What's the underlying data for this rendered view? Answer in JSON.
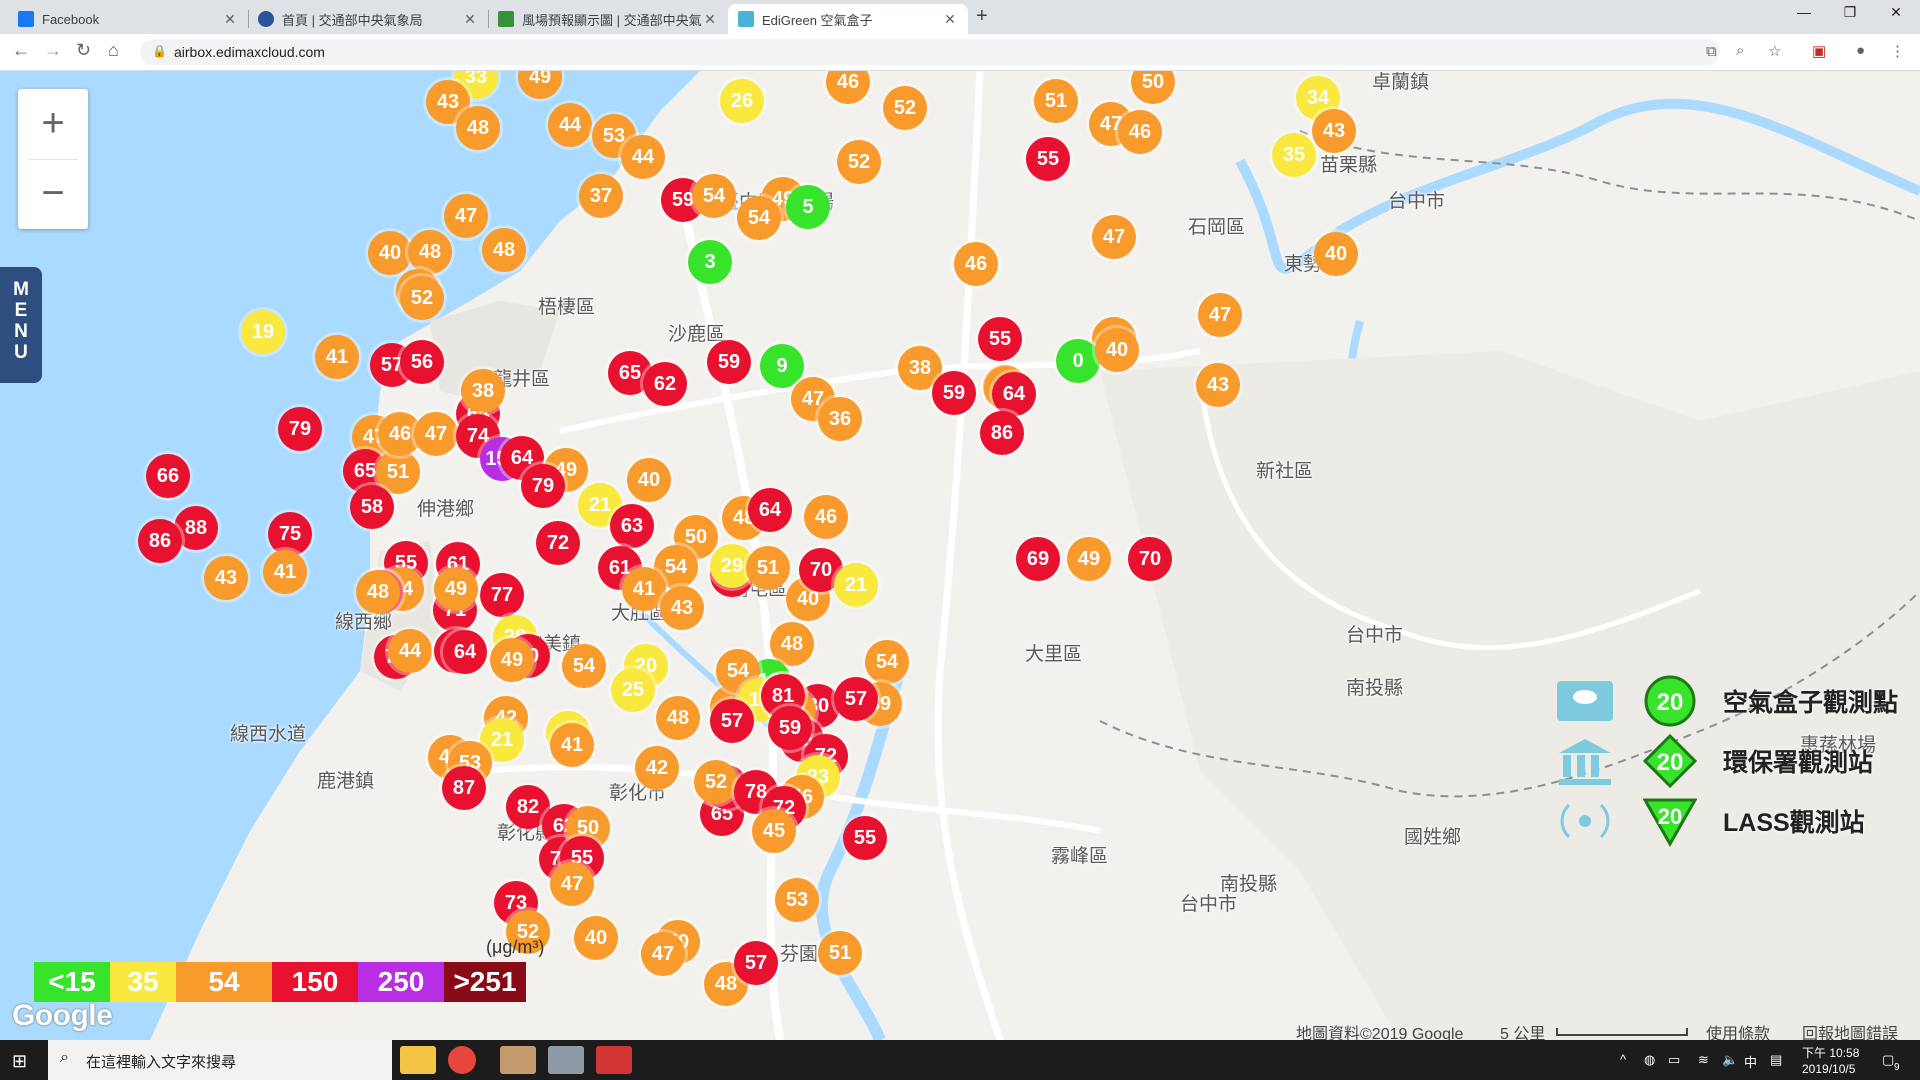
{
  "browser": {
    "tabs": [
      {
        "label": "Facebook",
        "icon_color": "#1877f2",
        "active": false
      },
      {
        "label": "首頁 | 交通部中央氣象局",
        "icon_color": "#2a5599",
        "active": false
      },
      {
        "label": "風場預報顯示圖 | 交通部中央氣象",
        "icon_color": "#3a8f3a",
        "active": false
      },
      {
        "label": "EdiGreen 空氣盒子",
        "icon_color": "#4ab4d8",
        "active": true
      }
    ],
    "url": "airbox.edimaxcloud.com"
  },
  "menu_label": "MENU",
  "map": {
    "labels": [
      {
        "text": "臺中國際機場"
      },
      {
        "text": "卓蘭鎮"
      },
      {
        "text": "東勢區"
      },
      {
        "text": "新社區"
      },
      {
        "text": "沙鹿區"
      },
      {
        "text": "龍井區"
      },
      {
        "text": "大肚區"
      },
      {
        "text": "線西鄉"
      },
      {
        "text": "鹿港鎮"
      },
      {
        "text": "彰化縣"
      },
      {
        "text": "彰化市"
      },
      {
        "text": "台中市"
      },
      {
        "text": "南投縣"
      },
      {
        "text": "國姓鄉"
      },
      {
        "text": "霧峰區"
      },
      {
        "text": "芬園鄉"
      },
      {
        "text": "惠蓀林場"
      },
      {
        "text": "苗栗縣"
      },
      {
        "text": "台中市"
      },
      {
        "text": "石岡區"
      },
      {
        "text": "梧棲區"
      },
      {
        "text": "伸港鄉"
      },
      {
        "text": "和美鎮"
      },
      {
        "text": "線西水道"
      },
      {
        "text": "南屯區"
      },
      {
        "text": "大里區"
      },
      {
        "text": "台中市"
      },
      {
        "text": "南投縣"
      }
    ],
    "markers": [
      33,
      49,
      43,
      48,
      44,
      53,
      26,
      46,
      52,
      51,
      50,
      34,
      43,
      35,
      47,
      46,
      55,
      44,
      37,
      59,
      54,
      49,
      5,
      54,
      52,
      47,
      47,
      46,
      40,
      48,
      48,
      50,
      52,
      40,
      3,
      47,
      40,
      55,
      38,
      50,
      19,
      64,
      41,
      57,
      56,
      38,
      65,
      62,
      59,
      9,
      47,
      36,
      50,
      0,
      40,
      43,
      59,
      64,
      86,
      79,
      47,
      65,
      51,
      46,
      47,
      74,
      151,
      64,
      49,
      79,
      40,
      21,
      48,
      46,
      66,
      88,
      86,
      75,
      58,
      63,
      72,
      50,
      64,
      70,
      69,
      49,
      43,
      41,
      55,
      44,
      56,
      48,
      61,
      71,
      77,
      54,
      61,
      41,
      63,
      29,
      40,
      51,
      70,
      21,
      78,
      44,
      71,
      64,
      49,
      28,
      60,
      43,
      48,
      12,
      41,
      54,
      80,
      39,
      57,
      49,
      54,
      20,
      25,
      54,
      42,
      21,
      32,
      48,
      15,
      37,
      38,
      66,
      72,
      23,
      81,
      42,
      41,
      59,
      57,
      65,
      61,
      52,
      46,
      78,
      72,
      45,
      44,
      53,
      87,
      82,
      62,
      72,
      50,
      55,
      47,
      73,
      52,
      40,
      40,
      48,
      57,
      47,
      53,
      51,
      55
    ]
  },
  "legend": {
    "scale": [
      {
        "label": "<15",
        "color": "#38e32c"
      },
      {
        "label": "35",
        "color": "#f9e83e"
      },
      {
        "label": "54",
        "color": "#f89a2c"
      },
      {
        "label": "150",
        "color": "#e8112f"
      },
      {
        "label": "250",
        "color": "#b82ee4"
      },
      {
        "label": ">251",
        "color": "#8a0b18"
      }
    ],
    "unit": "(μg/m³)",
    "stations": [
      {
        "label": "空氣盒子觀測點",
        "value": "20"
      },
      {
        "label": "環保署觀測站",
        "value": "20"
      },
      {
        "label": "LASS觀測站",
        "value": "20"
      }
    ]
  },
  "attribution": {
    "map_data": "地圖資料©2019 Google",
    "scale": "5 公里",
    "terms": "使用條款",
    "report": "回報地圖錯誤",
    "logo": "Google"
  },
  "taskbar": {
    "search_placeholder": "在這裡輸入文字來搜尋",
    "time": "下午 10:58",
    "date": "2019/10/5",
    "ime": "中",
    "notifications": "9"
  }
}
